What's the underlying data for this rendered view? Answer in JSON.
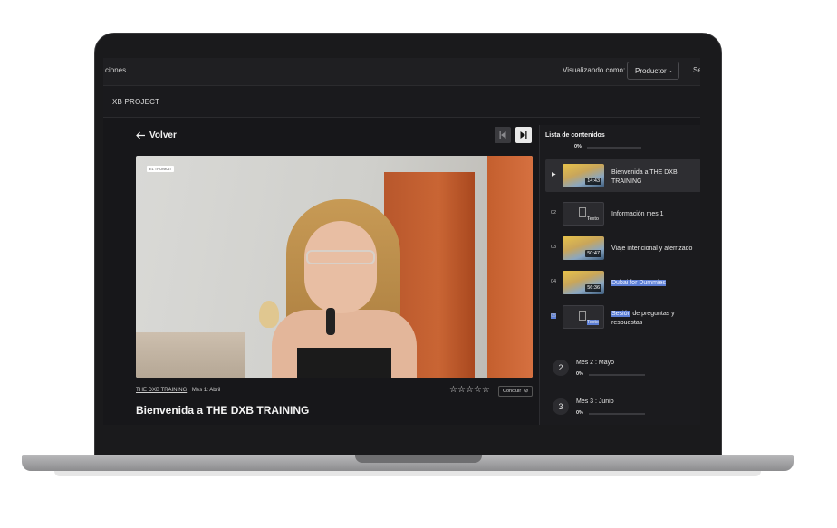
{
  "topbar": {
    "left_text": "ciones",
    "viewing_label": "Visualizando como:",
    "viewing_value": "Productor",
    "right_text": "Se"
  },
  "project": {
    "name": "XB PROJECT"
  },
  "player": {
    "back_label": "Volver",
    "video_badge": "EL TRUNKAT",
    "course_link": "THE DXB TRAINING",
    "module": "Mes 1: Abril",
    "conclude_label": "Concluir",
    "lesson_title": "Bienvenida a THE DXB TRAINING",
    "rating": {
      "max": 5,
      "value": 0
    }
  },
  "playlist": {
    "title": "Lista de contenidos",
    "top_progress": "0%",
    "items": [
      {
        "number": "",
        "type": "video",
        "duration": "14:43",
        "title": "Bienvenida a THE DXB TRAINING",
        "active": true
      },
      {
        "number": "02",
        "type": "text",
        "thumb_label": "Texto",
        "title": "Información mes 1"
      },
      {
        "number": "03",
        "type": "video",
        "duration": "50:47",
        "title": "Viaje intencional y aterrizado"
      },
      {
        "number": "04",
        "type": "video",
        "duration": "56:36",
        "title": "Dubai for Dummies"
      },
      {
        "number": "05",
        "type": "text",
        "thumb_label": "Texto",
        "title_highlight": "Sesión",
        "title_rest": " de preguntas y respuestas"
      }
    ],
    "months": [
      {
        "number": "2",
        "title": "Mes 2 : Mayo",
        "progress": "0%"
      },
      {
        "number": "3",
        "title": "Mes 3 : Junio",
        "progress": "0%"
      }
    ]
  },
  "colors": {
    "highlight": "#5d7fd6",
    "background": "#17171a"
  }
}
